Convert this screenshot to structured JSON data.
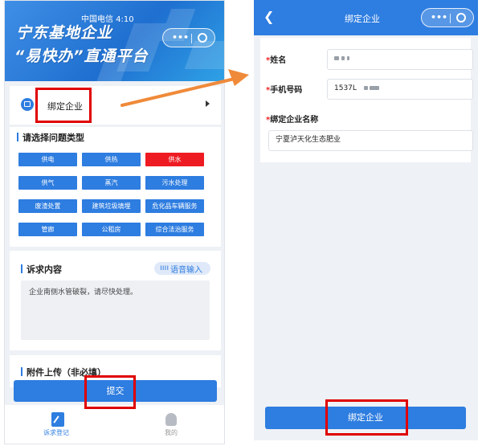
{
  "left": {
    "status_bar": "中国电信 4:10",
    "banner": {
      "line1": "宁东基地企业",
      "line2": "“易快办”直通平台"
    },
    "bind_row": {
      "label": "绑定企业"
    },
    "problem_types": {
      "title": "请选择问题类型",
      "buttons": [
        {
          "label": "供电",
          "selected": false
        },
        {
          "label": "供热",
          "selected": false
        },
        {
          "label": "供水",
          "selected": true
        },
        {
          "label": "供气",
          "selected": false
        },
        {
          "label": "蒸汽",
          "selected": false
        },
        {
          "label": "污水处理",
          "selected": false
        },
        {
          "label": "废渣处置",
          "selected": false
        },
        {
          "label": "建筑垃圾填埋",
          "selected": false
        },
        {
          "label": "危化品车辆服务",
          "selected": false
        },
        {
          "label": "管廊",
          "selected": false
        },
        {
          "label": "公租房",
          "selected": false
        },
        {
          "label": "综合法治服务",
          "selected": false
        }
      ]
    },
    "request": {
      "title": "诉求内容",
      "voice_button": "语音输入",
      "text": "企业南侧水管破裂，请尽快处理。"
    },
    "attachments": {
      "title": "附件上传（非必填）"
    },
    "submit_label": "提交",
    "tabs": [
      {
        "label": "诉求登记",
        "active": true
      },
      {
        "label": "我的",
        "active": false
      }
    ]
  },
  "right": {
    "title": "绑定企业",
    "fields": {
      "name_label": "姓名",
      "phone_label": "手机号码",
      "phone_value": "1537L",
      "company_label": "绑定企业名称",
      "company_value": "宁夏泸天化生态肥业"
    },
    "submit_label": "绑定企业"
  },
  "colors": {
    "primary": "#2e7de0",
    "selected": "#ee1c22",
    "highlight": "#e00000",
    "arrow": "#ef8a3a"
  }
}
